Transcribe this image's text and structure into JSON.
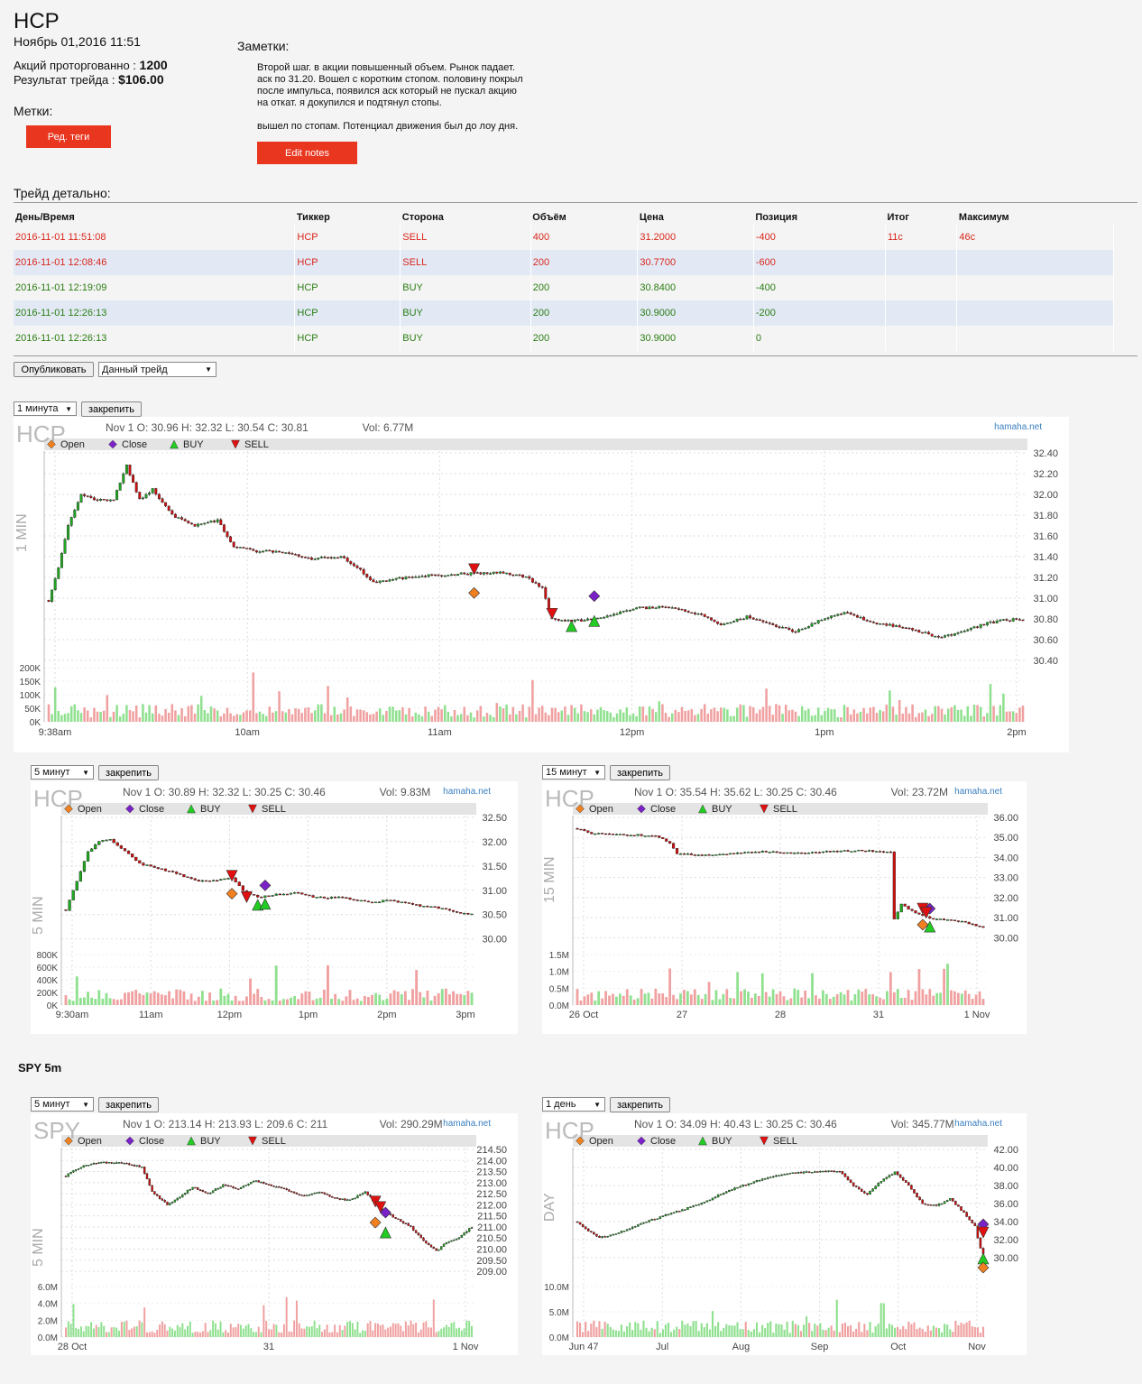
{
  "header": {
    "ticker": "HCP",
    "datetime": "Ноябрь 01,2016 11:51",
    "shares_label": "Акций проторгованно :",
    "shares_value": "1200",
    "result_label": "Результат трейда :",
    "result_value": "$106.00",
    "tags_label": "Метки:",
    "tags_button": "Ред. теги",
    "notes_label": "Заметки:",
    "notes_p1": "Второй шаг. в акции повышенный объем. Рынок падает.\nаск по 31.20. Вошел с коротким стопом. половину покрыл\nпосле импульса, появился аск который не пускал акцию\nна откат. я докупился и подтянул стопы.",
    "notes_p2": "вышел по стопам. Потенциал движения был до лоу дня.",
    "notes_button": "Edit notes"
  },
  "trade": {
    "title": "Трейд детально:",
    "columns": [
      "День/Время",
      "Тиккер",
      "Сторона",
      "Объём",
      "Цена",
      "Позиция",
      "Итог",
      "Максимум"
    ],
    "rows": [
      [
        "2016-11-01 11:51:08",
        "HCP",
        "SELL",
        "400",
        "31.2000",
        "-400",
        "11c",
        "46c"
      ],
      [
        "2016-11-01 12:08:46",
        "HCP",
        "SELL",
        "200",
        "30.7700",
        "-600",
        "",
        ""
      ],
      [
        "2016-11-01 12:19:09",
        "HCP",
        "BUY",
        "200",
        "30.8400",
        "-400",
        "",
        ""
      ],
      [
        "2016-11-01 12:26:13",
        "HCP",
        "BUY",
        "200",
        "30.9000",
        "-200",
        "",
        ""
      ],
      [
        "2016-11-01 12:26:13",
        "HCP",
        "BUY",
        "200",
        "30.9000",
        "0",
        "",
        ""
      ]
    ]
  },
  "controls": {
    "publish_button": "Опубликовать",
    "trade_select": "Данный трейд",
    "pin_label": "закрепить"
  },
  "spy_section_title": "SPY 5m",
  "watermark": "hamaha.net",
  "legend": {
    "open": "Open",
    "close": "Close",
    "buy": "BUY",
    "sell": "SELL"
  },
  "colors": {
    "up": "#1fa81f",
    "down": "#d01010",
    "vol_up": "#8fe08f",
    "vol_down": "#f0a0a0",
    "open": "#f08020",
    "close": "#7a22c8",
    "buy": "#22cc22",
    "sell": "#e01010",
    "accent": "#e8361f"
  },
  "chart_data": [
    {
      "id": "c1",
      "type": "candlestick",
      "symbol": "HCP",
      "interval_select": "1 минута",
      "side_label": "1 MIN",
      "info": "Nov 1 O: 30.96 H: 32.32 L: 30.54 C: 30.81",
      "vol_info": "Vol: 6.77M",
      "ylim": [
        30.4,
        32.4
      ],
      "yticks": [
        "32.40",
        "32.20",
        "32.00",
        "31.80",
        "31.60",
        "31.40",
        "31.20",
        "31.00",
        "30.80",
        "30.60",
        "30.40"
      ],
      "vol_ticks": [
        "200K",
        "150K",
        "100K",
        "50K",
        "0K"
      ],
      "vol_max": 200000,
      "xlabels": [
        "9:38am",
        "10am",
        "11am",
        "12pm",
        "1pm",
        "2pm"
      ],
      "path": [
        [
          0,
          30.98
        ],
        [
          3,
          31.3
        ],
        [
          6,
          31.7
        ],
        [
          10,
          32.0
        ],
        [
          15,
          31.95
        ],
        [
          20,
          31.95
        ],
        [
          24,
          32.28
        ],
        [
          28,
          31.95
        ],
        [
          32,
          32.05
        ],
        [
          38,
          31.8
        ],
        [
          45,
          31.7
        ],
        [
          52,
          31.75
        ],
        [
          57,
          31.5
        ],
        [
          64,
          31.45
        ],
        [
          72,
          31.45
        ],
        [
          80,
          31.38
        ],
        [
          90,
          31.4
        ],
        [
          95,
          31.3
        ],
        [
          100,
          31.15
        ],
        [
          110,
          31.2
        ],
        [
          118,
          31.22
        ],
        [
          125,
          31.23
        ],
        [
          140,
          31.25
        ],
        [
          147,
          31.2
        ],
        [
          152,
          31.1
        ],
        [
          155,
          30.8
        ],
        [
          164,
          30.78
        ],
        [
          170,
          30.82
        ],
        [
          175,
          30.85
        ],
        [
          180,
          30.9
        ],
        [
          190,
          30.92
        ],
        [
          200,
          30.85
        ],
        [
          207,
          30.74
        ],
        [
          215,
          30.82
        ],
        [
          225,
          30.72
        ],
        [
          230,
          30.68
        ],
        [
          240,
          30.82
        ],
        [
          245,
          30.86
        ],
        [
          255,
          30.76
        ],
        [
          265,
          30.7
        ],
        [
          270,
          30.66
        ],
        [
          275,
          30.62
        ],
        [
          285,
          30.72
        ],
        [
          292,
          30.78
        ],
        [
          300,
          30.8
        ]
      ],
      "n": 300,
      "markers": [
        {
          "kind": "sell",
          "i": 131,
          "price": 31.28
        },
        {
          "kind": "open",
          "i": 131,
          "price": 31.05
        },
        {
          "kind": "sell",
          "i": 155,
          "price": 30.85
        },
        {
          "kind": "buy",
          "i": 161,
          "price": 30.73
        },
        {
          "kind": "close",
          "i": 168,
          "price": 31.02
        },
        {
          "kind": "buy",
          "i": 168,
          "price": 30.78
        }
      ]
    },
    {
      "id": "c2",
      "type": "candlestick",
      "symbol": "HCP",
      "interval_select": "5 минут",
      "side_label": "5 MIN",
      "info": "Nov 1 O: 30.89 H: 32.32 L: 30.25 C: 30.46",
      "vol_info": "Vol: 9.83M",
      "ylim": [
        29.9,
        32.5
      ],
      "yticks": [
        "32.50",
        "32.00",
        "31.50",
        "31.00",
        "30.50",
        "30.00"
      ],
      "vol_ticks": [
        "800K",
        "600K",
        "400K",
        "200K",
        "0K"
      ],
      "vol_max": 800000,
      "xlabels": [
        "9:30am",
        "11am",
        "12pm",
        "1pm",
        "2pm",
        "3pm"
      ],
      "path": [
        [
          0,
          30.6
        ],
        [
          3,
          31.2
        ],
        [
          6,
          31.8
        ],
        [
          9,
          32.0
        ],
        [
          12,
          32.05
        ],
        [
          16,
          31.8
        ],
        [
          20,
          31.55
        ],
        [
          25,
          31.45
        ],
        [
          30,
          31.35
        ],
        [
          35,
          31.2
        ],
        [
          40,
          31.2
        ],
        [
          45,
          31.25
        ],
        [
          48,
          31.0
        ],
        [
          52,
          30.85
        ],
        [
          56,
          30.9
        ],
        [
          62,
          30.95
        ],
        [
          68,
          30.85
        ],
        [
          75,
          30.85
        ],
        [
          82,
          30.75
        ],
        [
          88,
          30.8
        ],
        [
          94,
          30.7
        ],
        [
          100,
          30.65
        ],
        [
          106,
          30.55
        ],
        [
          110,
          30.5
        ]
      ],
      "n": 110,
      "markers": [
        {
          "kind": "sell",
          "i": 45,
          "price": 31.3
        },
        {
          "kind": "open",
          "i": 45,
          "price": 30.93
        },
        {
          "kind": "sell",
          "i": 49,
          "price": 30.86
        },
        {
          "kind": "buy",
          "i": 52,
          "price": 30.7
        },
        {
          "kind": "close",
          "i": 54,
          "price": 31.1
        },
        {
          "kind": "buy",
          "i": 54,
          "price": 30.72
        }
      ]
    },
    {
      "id": "c3",
      "type": "candlestick",
      "symbol": "HCP",
      "interval_select": "15 минут",
      "side_label": "15 MIN",
      "info": "Nov 1 O: 35.54 H: 35.62 L: 30.25 C: 30.46",
      "vol_info": "Vol: 23.72M",
      "ylim": [
        29.7,
        36.0
      ],
      "yticks": [
        "36.00",
        "35.00",
        "34.00",
        "33.00",
        "32.00",
        "31.00",
        "30.00"
      ],
      "vol_ticks": [
        "1.5M",
        "1.0M",
        "0.5M",
        "0.0M"
      ],
      "vol_max": 1500000,
      "xlabels": [
        "26 Oct",
        "27",
        "28",
        "31",
        "1 Nov"
      ],
      "path": [
        [
          0,
          35.45
        ],
        [
          4,
          35.2
        ],
        [
          10,
          35.15
        ],
        [
          22,
          35.1
        ],
        [
          26,
          34.7
        ],
        [
          28,
          34.2
        ],
        [
          35,
          34.1
        ],
        [
          45,
          34.2
        ],
        [
          52,
          34.3
        ],
        [
          60,
          34.2
        ],
        [
          70,
          34.3
        ],
        [
          80,
          34.35
        ],
        [
          88,
          34.25
        ],
        [
          89,
          30.9
        ],
        [
          91,
          31.7
        ],
        [
          95,
          31.2
        ],
        [
          100,
          30.95
        ],
        [
          108,
          30.8
        ],
        [
          114,
          30.5
        ]
      ],
      "n": 114,
      "markers": [
        {
          "kind": "sell",
          "i": 97,
          "price": 31.45
        },
        {
          "kind": "open",
          "i": 97,
          "price": 30.65
        },
        {
          "kind": "close",
          "i": 99,
          "price": 31.45
        },
        {
          "kind": "sell",
          "i": 98,
          "price": 31.25
        },
        {
          "kind": "buy",
          "i": 99,
          "price": 30.55
        }
      ]
    },
    {
      "id": "c4",
      "type": "candlestick",
      "symbol": "SPY",
      "interval_select": "5 минут",
      "side_label": "5 MIN",
      "info": "Nov 1 O: 213.14 H: 213.93 L: 209.6 C: 211",
      "vol_info": "Vol: 290.29M",
      "ylim": [
        208.8,
        214.5
      ],
      "yticks": [
        "214.50",
        "214.00",
        "213.50",
        "213.00",
        "212.50",
        "212.00",
        "211.50",
        "211.00",
        "210.50",
        "210.00",
        "209.50",
        "209.00"
      ],
      "vol_ticks": [
        "6.0M",
        "4.0M",
        "2.0M",
        "0.0M"
      ],
      "vol_max": 6000000,
      "xlabels": [
        "28 Oct",
        "31",
        "1 Nov"
      ],
      "path": [
        [
          0,
          213.3
        ],
        [
          4,
          213.6
        ],
        [
          8,
          213.8
        ],
        [
          14,
          213.9
        ],
        [
          22,
          213.9
        ],
        [
          30,
          213.7
        ],
        [
          34,
          212.6
        ],
        [
          40,
          212.0
        ],
        [
          44,
          212.3
        ],
        [
          50,
          212.8
        ],
        [
          56,
          212.5
        ],
        [
          62,
          212.9
        ],
        [
          68,
          212.7
        ],
        [
          74,
          213.1
        ],
        [
          80,
          212.9
        ],
        [
          86,
          212.7
        ],
        [
          94,
          212.4
        ],
        [
          100,
          212.6
        ],
        [
          106,
          212.3
        ],
        [
          112,
          212.2
        ],
        [
          118,
          212.6
        ],
        [
          124,
          211.8
        ],
        [
          130,
          211.4
        ],
        [
          136,
          211.0
        ],
        [
          140,
          210.5
        ],
        [
          146,
          209.9
        ],
        [
          150,
          210.3
        ],
        [
          156,
          210.6
        ],
        [
          160,
          211.0
        ]
      ],
      "n": 160,
      "markers": [
        {
          "kind": "sell",
          "i": 122,
          "price": 212.15
        },
        {
          "kind": "open",
          "i": 122,
          "price": 211.2
        },
        {
          "kind": "sell",
          "i": 124,
          "price": 211.9
        },
        {
          "kind": "close",
          "i": 126,
          "price": 211.65
        },
        {
          "kind": "buy",
          "i": 126,
          "price": 210.75
        }
      ]
    },
    {
      "id": "c5",
      "type": "candlestick",
      "symbol": "HCP",
      "interval_select": "1 день",
      "side_label": "DAY",
      "info": "Nov 1 O: 34.09 H: 40.43 L: 30.25 C: 30.46",
      "vol_info": "Vol: 345.77M",
      "ylim": [
        28.0,
        42.0
      ],
      "yticks": [
        "42.00",
        "40.00",
        "38.00",
        "36.00",
        "34.00",
        "32.00",
        "30.00"
      ],
      "vol_ticks": [
        "10.0M",
        "5.0M",
        "0.0M"
      ],
      "vol_max": 12000000,
      "xlabels": [
        "Jun 47",
        "Jul",
        "Aug",
        "Sep",
        "Oct",
        "Nov"
      ],
      "path": [
        [
          0,
          34.0
        ],
        [
          4,
          33.0
        ],
        [
          8,
          32.2
        ],
        [
          15,
          32.8
        ],
        [
          25,
          34.0
        ],
        [
          35,
          35.0
        ],
        [
          45,
          36.0
        ],
        [
          55,
          37.5
        ],
        [
          65,
          38.5
        ],
        [
          75,
          39.3
        ],
        [
          85,
          39.5
        ],
        [
          95,
          39.6
        ],
        [
          100,
          38.0
        ],
        [
          105,
          37.0
        ],
        [
          110,
          38.5
        ],
        [
          115,
          39.5
        ],
        [
          120,
          38.0
        ],
        [
          125,
          36.0
        ],
        [
          130,
          35.8
        ],
        [
          135,
          36.5
        ],
        [
          140,
          35.0
        ],
        [
          144,
          33.5
        ],
        [
          146,
          31.0
        ],
        [
          147,
          30.46
        ]
      ],
      "n": 147,
      "markers": [
        {
          "kind": "close",
          "i": 147,
          "price": 33.7
        },
        {
          "kind": "sell",
          "i": 147,
          "price": 32.8
        },
        {
          "kind": "buy",
          "i": 147,
          "price": 29.9
        },
        {
          "kind": "open",
          "i": 147,
          "price": 28.9
        }
      ]
    }
  ]
}
